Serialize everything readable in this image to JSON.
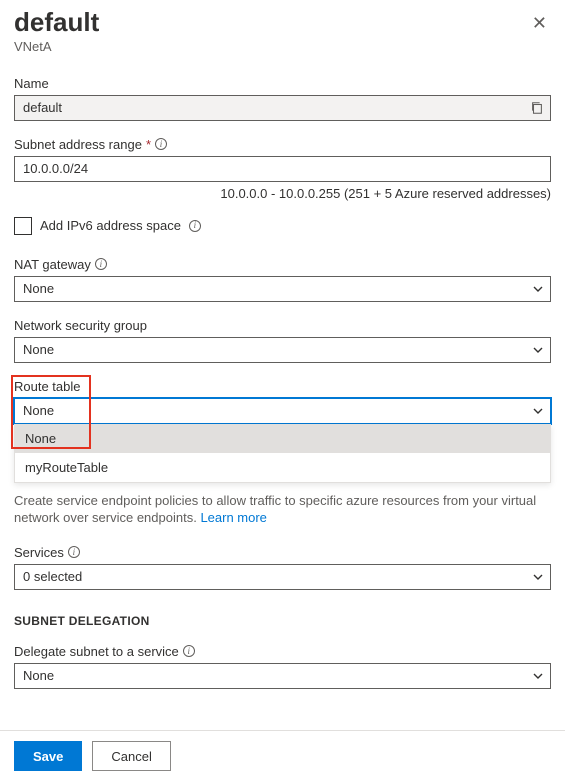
{
  "header": {
    "title": "default",
    "subtitle": "VNetA"
  },
  "fields": {
    "name": {
      "label": "Name",
      "value": "default"
    },
    "subnetRange": {
      "label": "Subnet address range",
      "value": "10.0.0.0/24",
      "helper": "10.0.0.0 - 10.0.0.255 (251 + 5 Azure reserved addresses)"
    },
    "addIpv6": {
      "label": "Add IPv6 address space"
    },
    "natGateway": {
      "label": "NAT gateway",
      "value": "None"
    },
    "nsg": {
      "label": "Network security group",
      "value": "None"
    },
    "routeTable": {
      "label": "Route table",
      "value": "None",
      "options": [
        "None",
        "myRouteTable"
      ]
    },
    "serviceEndpointsDesc": "Create service endpoint policies to allow traffic to specific azure resources from your virtual network over service endpoints.",
    "learnMore": "Learn more",
    "services": {
      "label": "Services",
      "value": "0 selected"
    },
    "delegationHeading": "SUBNET DELEGATION",
    "delegate": {
      "label": "Delegate subnet to a service",
      "value": "None"
    }
  },
  "footer": {
    "save": "Save",
    "cancel": "Cancel"
  }
}
